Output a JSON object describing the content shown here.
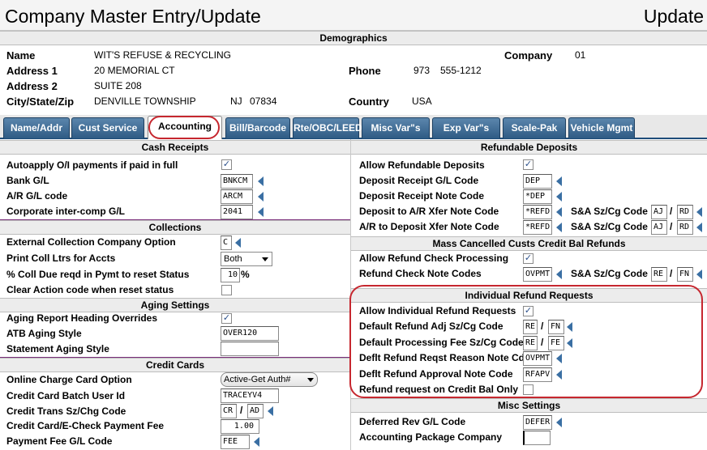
{
  "window": {
    "title": "Company Master Entry/Update",
    "mode": "Update"
  },
  "demographics": {
    "header": "Demographics",
    "name_label": "Name",
    "name_value": "WIT'S REFUSE & RECYCLING",
    "address1_label": "Address 1",
    "address1_value": "20 MEMORIAL CT",
    "address2_label": "Address 2",
    "address2_value": "SUITE 208",
    "city_label": "City/State/Zip",
    "city_value": "DENVILLE TOWNSHIP",
    "state_value": "NJ",
    "zip_value": "07834",
    "company_label": "Company",
    "company_value": "01",
    "phone_label": "Phone",
    "phone_area": "973",
    "phone_number": "555-1212",
    "country_label": "Country",
    "country_value": "USA"
  },
  "tabs": [
    {
      "label": "Name/Addr"
    },
    {
      "label": "Cust Service"
    },
    {
      "label": "Accounting"
    },
    {
      "label": "Bill/Barcode"
    },
    {
      "label": "Rte/OBC/LEED"
    },
    {
      "label": "Misc Var\"s"
    },
    {
      "label": "Exp Var\"s"
    },
    {
      "label": "Scale-Pak"
    },
    {
      "label": "Vehicle Mgmt"
    }
  ],
  "cash_receipts": {
    "header": "Cash Receipts",
    "autoapply_label": "Autoapply O/I payments if paid in full",
    "autoapply_checked": true,
    "bank_gl_label": "Bank G/L",
    "bank_gl_value": "BNKCM",
    "ar_gl_label": "A/R G/L code",
    "ar_gl_value": "ARCM",
    "corp_label": "Corporate inter-comp G/L",
    "corp_value": "2041"
  },
  "collections": {
    "header": "Collections",
    "ext_label": "External Collection Company Option",
    "ext_value": "C",
    "print_label": "Print Coll Ltrs for Accts",
    "print_value": "Both",
    "pct_label": "% Coll Due reqd in Pymt to reset Status",
    "pct_value": "10",
    "pct_suffix": "%",
    "clear_label": "Clear Action code when reset status",
    "clear_checked": false
  },
  "aging": {
    "header": "Aging Settings",
    "overrides_label": "Aging Report Heading Overrides",
    "overrides_checked": true,
    "atb_label": "ATB Aging Style",
    "atb_value": "OVER120",
    "stmt_label": "Statement Aging Style",
    "stmt_value": ""
  },
  "credit_cards": {
    "header": "Credit Cards",
    "online_label": "Online Charge Card Option",
    "online_value": "Active-Get Auth#",
    "batch_label": "Credit Card Batch User Id",
    "batch_value": "TRACEYV4",
    "trans_label": "Credit Trans Sz/Chg Code",
    "trans_sz": "CR",
    "trans_cg": "AD",
    "fee_label": "Credit Card/E-Check Payment Fee",
    "fee_value": "1.00",
    "feegl_label": "Payment Fee G/L Code",
    "feegl_value": "FEE"
  },
  "refundable_deposits": {
    "header": "Refundable Deposits",
    "allow_label": "Allow Refundable Deposits",
    "allow_checked": true,
    "receipt_gl_label": "Deposit Receipt G/L Code",
    "receipt_gl_value": "DEP",
    "receipt_note_label": "Deposit Receipt Note Code",
    "receipt_note_value": "*DEP",
    "dep_ar_label": "Deposit to A/R Xfer Note Code",
    "dep_ar_value": "*REFD",
    "ar_dep_label": "A/R to Deposit Xfer Note Code",
    "ar_dep_value": "*REFD",
    "sa_label": "S&A Sz/Cg Code",
    "sa1_sz": "AJ",
    "sa1_cg": "RD",
    "sa2_sz": "AJ",
    "sa2_cg": "RD"
  },
  "mass_cancelled": {
    "header": "Mass Cancelled Custs Credit Bal Refunds",
    "allow_label": "Allow Refund Check Processing",
    "allow_checked": true,
    "note_label": "Refund Check Note Codes",
    "note_value": "OVPMT",
    "sa_label": "S&A Sz/Cg Code",
    "sa_sz": "RE",
    "sa_cg": "FN"
  },
  "individual_refund": {
    "header": "Individual Refund Requests",
    "allow_label": "Allow Individual Refund Requests",
    "allow_checked": true,
    "adj_label": "Default Refund Adj Sz/Cg Code",
    "adj_sz": "RE",
    "adj_cg": "FN",
    "fee_label": "Default Processing Fee Sz/Cg Code",
    "fee_sz": "RE",
    "fee_cg": "FE",
    "reason_label": "Deflt Refund Reqst Reason Note Cd",
    "reason_value": "OVPMT",
    "approval_label": "Deflt Refund Approval Note Code",
    "approval_value": "RFAPV",
    "credit_only_label": "Refund request on Credit Bal Only",
    "credit_only_checked": false
  },
  "misc_settings": {
    "header": "Misc Settings",
    "deferred_label": "Deferred Rev G/L Code",
    "deferred_value": "DEFER",
    "package_label": "Accounting Package Company",
    "package_value": ""
  },
  "slash": "/",
  "colors": {
    "tab_blue": "#2f5b84",
    "highlight_red": "#c6272f",
    "divider_purple": "#7a2d7a"
  }
}
